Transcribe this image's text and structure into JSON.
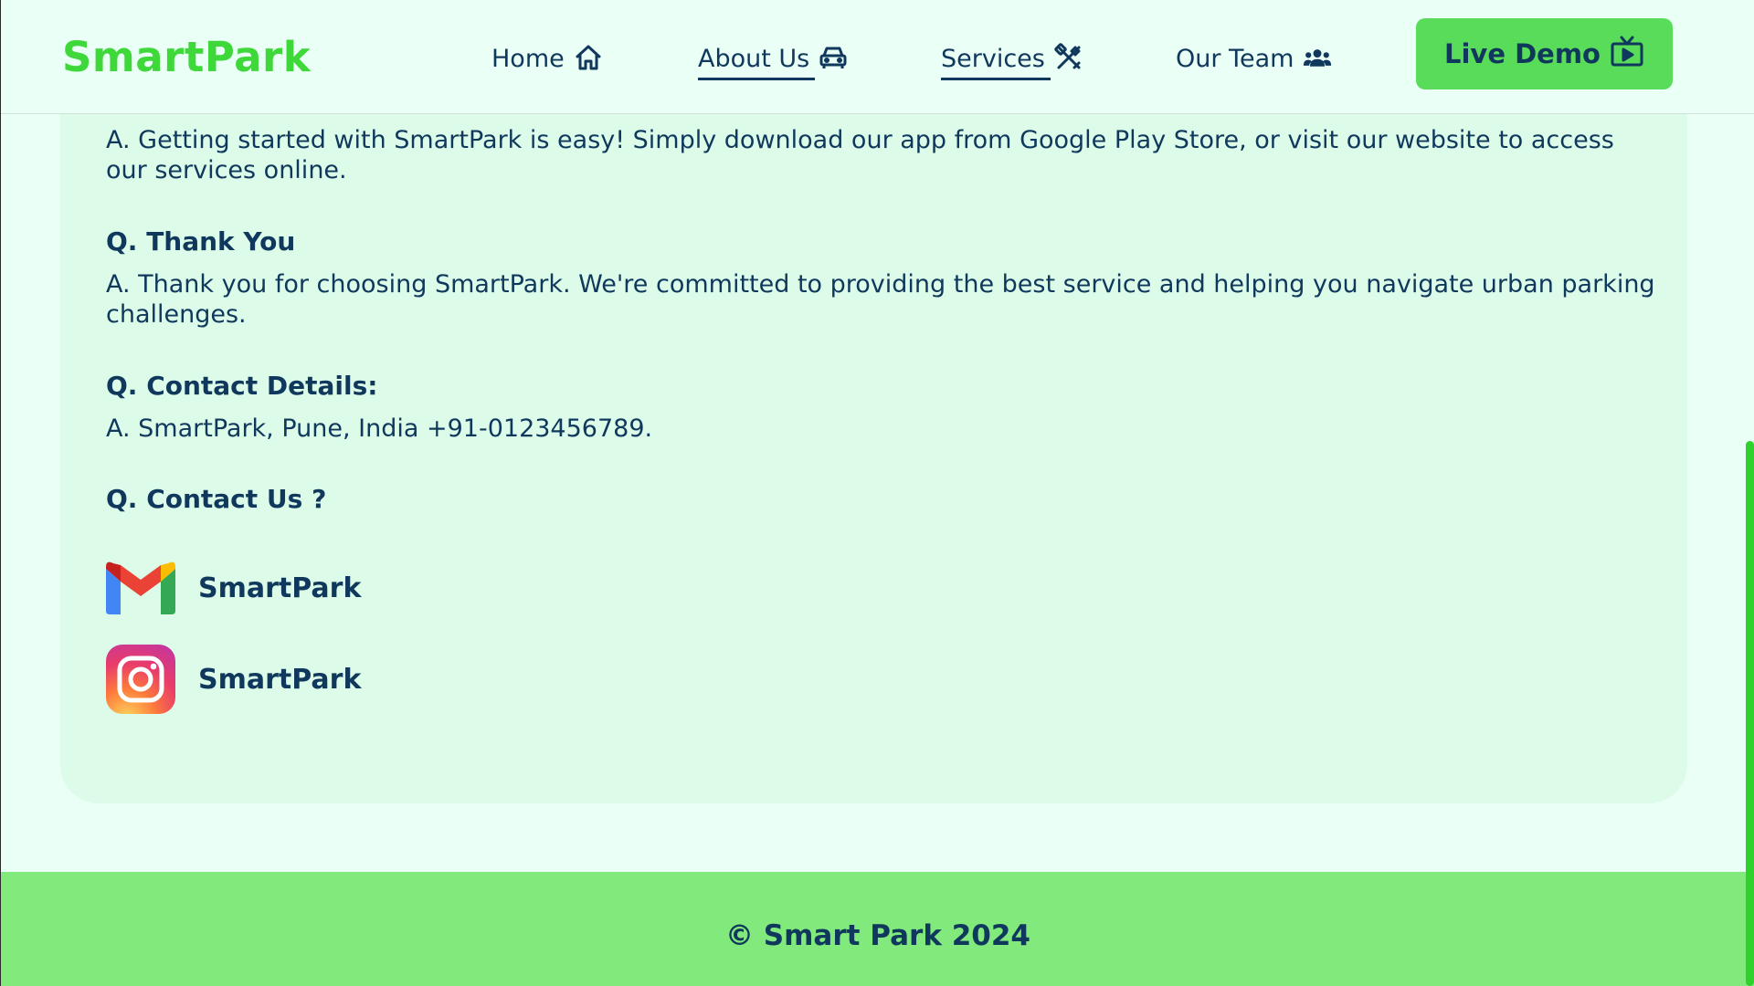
{
  "brand": {
    "name": "SmartPark",
    "color": "#3fd83a"
  },
  "nav": {
    "items": [
      {
        "label": "Home",
        "icon": "home-icon"
      },
      {
        "label": "About Us",
        "icon": "car-icon"
      },
      {
        "label": "Services",
        "icon": "tools-icon"
      },
      {
        "label": "Our Team",
        "icon": "team-icon"
      }
    ],
    "cta_label": "Live Demo",
    "cta_icon": "tv-play-icon"
  },
  "faq": [
    {
      "question": "",
      "answer": "A. Getting started with SmartPark is easy! Simply download our app from Google Play Store, or visit our website to access our services online."
    },
    {
      "question": "Q. Thank You",
      "answer": "A. Thank you for choosing SmartPark. We're committed to providing the best service and helping you navigate urban parking challenges."
    },
    {
      "question": "Q. Contact Details:",
      "answer": "A. SmartPark, Pune, India +91-0123456789."
    },
    {
      "question": "Q. Contact Us ?",
      "answer": ""
    }
  ],
  "contacts": [
    {
      "label": "SmartPark",
      "icon": "gmail-icon"
    },
    {
      "label": "SmartPark",
      "icon": "instagram-icon"
    }
  ],
  "footer": {
    "text": "© Smart Park 2024"
  },
  "colors": {
    "accent": "#58dc59",
    "text": "#10385c",
    "page_bg": "#eafff6",
    "card_bg": "#dcfce9",
    "footer_bg": "#82ea7d"
  }
}
